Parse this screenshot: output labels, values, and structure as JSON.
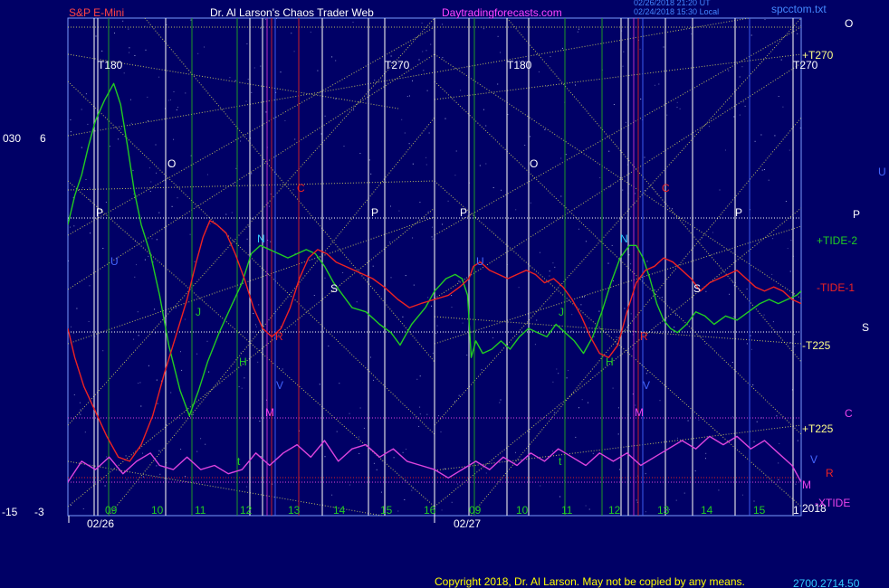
{
  "header": {
    "instrument": "S&P E-Mini",
    "site": "Dr. Al Larson's Chaos Trader Web",
    "url": "Daytradingforecasts.com",
    "stamp_1": "02/26/2018 21:20 UT",
    "stamp_2": "02/24/2018 15:30 Local",
    "file": "spcctom.txt",
    "corner": "O",
    "copyright": "Copyright 2018, Dr. Al Larson. May not be copied by any means.",
    "footer_price": "2700.2714.50"
  },
  "y_axis": {
    "top_left": "030",
    "top_right": "6",
    "bottom_left": "-15",
    "bottom_right": "-3"
  },
  "x_axis": {
    "hour_labels_day1": [
      "09",
      "10",
      "11",
      "12",
      "13",
      "14",
      "15",
      "16"
    ],
    "hour_labels_day2": [
      "09",
      "10",
      "11",
      "12",
      "13",
      "14",
      "15"
    ],
    "date_1": "02/26",
    "date_2": "02/27",
    "year": "2018",
    "year_prefix": "1"
  },
  "colors": {
    "background": "#000066",
    "frame": "#7a9cff",
    "tide_plus": "#22cc22",
    "tide_minus": "#ee2222",
    "xtide": "#dd44dd",
    "grid_yellow": "#e8e860",
    "white_line": "#f0f0f0",
    "green_line": "#22aa22",
    "red_line": "#dd2222",
    "magenta_line": "#cc33cc",
    "blue_line": "#4466ff"
  },
  "right_labels": {
    "t270": "+T270",
    "u": "U",
    "p": "P",
    "tide2": "+TIDE-2",
    "tide1": "-TIDE-1",
    "s": "S",
    "t225_minus": "-T225",
    "c": "C",
    "t225_plus": "+T225",
    "v": "V",
    "r": "R",
    "m": "M",
    "xtide": "-XTIDE"
  },
  "plot_labels": {
    "t180_a": "T180",
    "t270_a": "T270",
    "t180_b": "T180",
    "t270_b": "T270",
    "o_a": "O",
    "o_b": "O",
    "p_a": "P",
    "p_b": "P",
    "p_c": "P",
    "p_d": "P",
    "c_a": "C",
    "c_b": "C",
    "n_a": "N",
    "n_b": "N",
    "s_a": "S",
    "s_b": "S",
    "j_a": "J",
    "j_b": "J",
    "h_a": "H",
    "h_b": "H",
    "m_a": "M",
    "m_b": "M",
    "v_a": "V",
    "v_b": "V",
    "r_a": "R",
    "r_b": "R",
    "t_a": "t",
    "t_b": "t",
    "u_a": "U",
    "u_b": "U"
  },
  "chart_data": {
    "type": "line",
    "y_range": [
      -3,
      6
    ],
    "x_range": [
      0,
      16
    ],
    "series": [
      {
        "name": "+TIDE-2",
        "color": "#22cc22",
        "points": [
          [
            0,
            3.9
          ],
          [
            0.15,
            4.6
          ],
          [
            0.3,
            5.1
          ],
          [
            0.45,
            5.8
          ],
          [
            0.6,
            6.4
          ],
          [
            0.8,
            6.9
          ],
          [
            1.0,
            7.3
          ],
          [
            1.15,
            6.8
          ],
          [
            1.3,
            5.8
          ],
          [
            1.45,
            4.7
          ],
          [
            1.6,
            3.9
          ],
          [
            1.8,
            3.2
          ],
          [
            2.0,
            2.2
          ],
          [
            2.2,
            1.0
          ],
          [
            2.45,
            -0.1
          ],
          [
            2.65,
            -0.7
          ],
          [
            2.85,
            -0.1
          ],
          [
            3.05,
            0.6
          ],
          [
            3.3,
            1.3
          ],
          [
            3.55,
            1.9
          ],
          [
            3.8,
            2.5
          ],
          [
            4.0,
            3.2
          ],
          [
            4.2,
            3.4
          ],
          [
            4.4,
            3.3
          ],
          [
            4.6,
            3.2
          ],
          [
            4.8,
            3.1
          ],
          [
            5.0,
            3.2
          ],
          [
            5.2,
            3.3
          ],
          [
            5.4,
            3.2
          ],
          [
            5.6,
            2.9
          ],
          [
            5.8,
            2.5
          ],
          [
            6.0,
            2.2
          ],
          [
            6.2,
            1.9
          ],
          [
            6.5,
            1.8
          ],
          [
            6.8,
            1.5
          ],
          [
            7.05,
            1.3
          ],
          [
            7.25,
            1.0
          ],
          [
            7.5,
            1.5
          ],
          [
            7.8,
            1.9
          ],
          [
            8.0,
            2.3
          ],
          [
            8.25,
            2.6
          ],
          [
            8.45,
            2.7
          ],
          [
            8.6,
            2.6
          ],
          [
            8.72,
            2.2
          ],
          [
            8.8,
            0.7
          ],
          [
            8.9,
            1.1
          ],
          [
            9.05,
            0.8
          ],
          [
            9.25,
            0.9
          ],
          [
            9.45,
            1.1
          ],
          [
            9.65,
            0.9
          ],
          [
            9.85,
            1.2
          ],
          [
            10.05,
            1.4
          ],
          [
            10.25,
            1.3
          ],
          [
            10.45,
            1.2
          ],
          [
            10.65,
            1.5
          ],
          [
            10.85,
            1.3
          ],
          [
            11.05,
            1.1
          ],
          [
            11.25,
            0.8
          ],
          [
            11.45,
            1.2
          ],
          [
            11.65,
            1.8
          ],
          [
            11.85,
            2.5
          ],
          [
            12.05,
            3.1
          ],
          [
            12.25,
            3.4
          ],
          [
            12.4,
            3.4
          ],
          [
            12.55,
            3.1
          ],
          [
            12.7,
            2.6
          ],
          [
            12.85,
            2.0
          ],
          [
            13.0,
            1.6
          ],
          [
            13.15,
            1.4
          ],
          [
            13.3,
            1.3
          ],
          [
            13.5,
            1.5
          ],
          [
            13.7,
            1.8
          ],
          [
            13.9,
            1.7
          ],
          [
            14.1,
            1.5
          ],
          [
            14.35,
            1.7
          ],
          [
            14.6,
            1.6
          ],
          [
            14.85,
            1.8
          ],
          [
            15.1,
            2.0
          ],
          [
            15.3,
            2.1
          ],
          [
            15.5,
            2.0
          ],
          [
            15.7,
            2.1
          ],
          [
            15.9,
            2.2
          ],
          [
            16.0,
            2.3
          ]
        ]
      },
      {
        "name": "-TIDE-1",
        "color": "#ee2222",
        "points": [
          [
            0,
            1.4
          ],
          [
            0.15,
            0.7
          ],
          [
            0.35,
            0.0
          ],
          [
            0.6,
            -0.6
          ],
          [
            0.85,
            -1.2
          ],
          [
            1.1,
            -1.7
          ],
          [
            1.35,
            -1.8
          ],
          [
            1.6,
            -1.4
          ],
          [
            1.85,
            -0.7
          ],
          [
            2.1,
            0.3
          ],
          [
            2.35,
            1.2
          ],
          [
            2.6,
            2.1
          ],
          [
            2.8,
            3.0
          ],
          [
            2.95,
            3.6
          ],
          [
            3.1,
            4.0
          ],
          [
            3.25,
            3.9
          ],
          [
            3.45,
            3.7
          ],
          [
            3.65,
            3.2
          ],
          [
            3.85,
            2.6
          ],
          [
            4.05,
            1.9
          ],
          [
            4.25,
            1.4
          ],
          [
            4.45,
            1.2
          ],
          [
            4.65,
            1.4
          ],
          [
            4.85,
            1.9
          ],
          [
            5.05,
            2.6
          ],
          [
            5.25,
            3.1
          ],
          [
            5.45,
            3.3
          ],
          [
            5.65,
            3.2
          ],
          [
            5.85,
            3.0
          ],
          [
            6.05,
            2.9
          ],
          [
            6.25,
            2.8
          ],
          [
            6.45,
            2.7
          ],
          [
            6.65,
            2.6
          ],
          [
            6.9,
            2.4
          ],
          [
            7.2,
            2.1
          ],
          [
            7.45,
            1.9
          ],
          [
            7.7,
            2.0
          ],
          [
            8.0,
            2.1
          ],
          [
            8.3,
            2.2
          ],
          [
            8.55,
            2.4
          ],
          [
            8.75,
            2.6
          ],
          [
            8.85,
            2.9
          ],
          [
            9.0,
            3.0
          ],
          [
            9.2,
            2.8
          ],
          [
            9.4,
            2.7
          ],
          [
            9.6,
            2.6
          ],
          [
            9.8,
            2.7
          ],
          [
            10.0,
            2.8
          ],
          [
            10.2,
            2.7
          ],
          [
            10.4,
            2.5
          ],
          [
            10.6,
            2.6
          ],
          [
            10.8,
            2.4
          ],
          [
            11.0,
            2.1
          ],
          [
            11.2,
            1.7
          ],
          [
            11.4,
            1.2
          ],
          [
            11.6,
            0.8
          ],
          [
            11.8,
            0.7
          ],
          [
            12.0,
            1.0
          ],
          [
            12.2,
            1.8
          ],
          [
            12.4,
            2.5
          ],
          [
            12.6,
            2.8
          ],
          [
            12.8,
            2.9
          ],
          [
            13.0,
            3.1
          ],
          [
            13.2,
            3.0
          ],
          [
            13.4,
            2.8
          ],
          [
            13.6,
            2.6
          ],
          [
            13.8,
            2.3
          ],
          [
            14.0,
            2.5
          ],
          [
            14.2,
            2.6
          ],
          [
            14.4,
            2.7
          ],
          [
            14.6,
            2.8
          ],
          [
            14.8,
            2.6
          ],
          [
            15.0,
            2.4
          ],
          [
            15.2,
            2.3
          ],
          [
            15.4,
            2.4
          ],
          [
            15.6,
            2.3
          ],
          [
            15.8,
            2.1
          ],
          [
            16.0,
            2.0
          ]
        ]
      },
      {
        "name": "-XTIDE",
        "color": "#dd44dd",
        "points": [
          [
            0,
            -2.3
          ],
          [
            0.3,
            -1.8
          ],
          [
            0.6,
            -2.0
          ],
          [
            0.9,
            -1.7
          ],
          [
            1.2,
            -2.1
          ],
          [
            1.5,
            -1.8
          ],
          [
            1.8,
            -1.6
          ],
          [
            2.0,
            -1.9
          ],
          [
            2.3,
            -2.0
          ],
          [
            2.6,
            -1.7
          ],
          [
            2.9,
            -2.0
          ],
          [
            3.2,
            -1.9
          ],
          [
            3.5,
            -2.1
          ],
          [
            3.8,
            -2.0
          ],
          [
            4.1,
            -1.6
          ],
          [
            4.4,
            -1.9
          ],
          [
            4.7,
            -1.6
          ],
          [
            5.0,
            -1.4
          ],
          [
            5.3,
            -1.7
          ],
          [
            5.6,
            -1.3
          ],
          [
            5.9,
            -1.8
          ],
          [
            6.2,
            -1.5
          ],
          [
            6.5,
            -1.4
          ],
          [
            6.8,
            -1.7
          ],
          [
            7.1,
            -1.5
          ],
          [
            7.4,
            -1.8
          ],
          [
            7.7,
            -1.9
          ],
          [
            8.0,
            -2.0
          ],
          [
            8.3,
            -2.2
          ],
          [
            8.6,
            -2.0
          ],
          [
            8.9,
            -1.8
          ],
          [
            9.2,
            -2.0
          ],
          [
            9.5,
            -1.7
          ],
          [
            9.8,
            -1.9
          ],
          [
            10.1,
            -1.6
          ],
          [
            10.4,
            -1.8
          ],
          [
            10.7,
            -1.5
          ],
          [
            11.0,
            -1.7
          ],
          [
            11.3,
            -1.9
          ],
          [
            11.6,
            -1.6
          ],
          [
            11.9,
            -1.8
          ],
          [
            12.2,
            -1.6
          ],
          [
            12.5,
            -1.9
          ],
          [
            12.8,
            -1.7
          ],
          [
            13.1,
            -1.5
          ],
          [
            13.4,
            -1.3
          ],
          [
            13.7,
            -1.5
          ],
          [
            14.0,
            -1.2
          ],
          [
            14.3,
            -1.4
          ],
          [
            14.6,
            -1.2
          ],
          [
            14.9,
            -1.5
          ],
          [
            15.2,
            -1.3
          ],
          [
            15.5,
            -1.6
          ],
          [
            15.8,
            -1.9
          ],
          [
            16.0,
            -2.3
          ]
        ]
      }
    ]
  }
}
